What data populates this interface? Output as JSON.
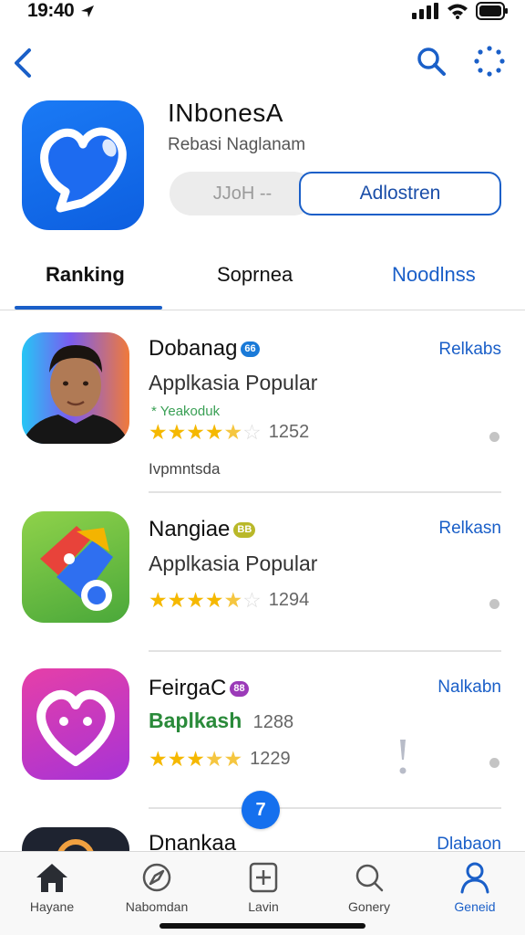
{
  "status_bar": {
    "time": "19:40"
  },
  "nav": {
    "back_icon": "chevron-left-icon",
    "search_icon": "search-icon",
    "more_icon": "dotted-circle-icon"
  },
  "hero": {
    "title": "INbonesA",
    "subtitle": "Rebasi Naglanam",
    "get_button": "JJoH --",
    "open_button": "Adlostren",
    "icon_color": "#1a7af5"
  },
  "tabs": [
    {
      "label": "Ranking",
      "active": true
    },
    {
      "label": "Soprnea",
      "active": false
    },
    {
      "label": "Noodlnss",
      "active": false
    }
  ],
  "apps": [
    {
      "name": "Dobanag",
      "badge": "66",
      "badge_color": "#1a7ad8",
      "category": "Applkasia Popular",
      "tag": "* Yeakoduk",
      "rating": 4.5,
      "rating_count": "1252",
      "note": "Ivpmntsda",
      "action": "Relkabs"
    },
    {
      "name": "Nangiae",
      "badge": "BB",
      "badge_color": "#b9b829",
      "category": "Applkasia Popular",
      "rating": 4.5,
      "rating_count": "1294",
      "action": "Relkasn"
    },
    {
      "name": "FeirgaC",
      "badge": "88",
      "badge_color": "#9b3ab8",
      "category": "Baplkash",
      "category_count": "1288",
      "rating": 4.5,
      "rating_count": "1229",
      "action": "Nalkabn"
    },
    {
      "name": "Dnankaa",
      "action": "Dlabaon"
    }
  ],
  "floating_badge": "7",
  "tab_bar": [
    {
      "label": "Hayane",
      "icon": "home-icon",
      "active": false
    },
    {
      "label": "Nabomdan",
      "icon": "compass-icon",
      "active": false
    },
    {
      "label": "Lavin",
      "icon": "plus-square-icon",
      "active": false
    },
    {
      "label": "Gonery",
      "icon": "search-icon",
      "active": false
    },
    {
      "label": "Geneid",
      "icon": "person-icon",
      "active": true
    }
  ],
  "colors": {
    "accent": "#1a5fc8",
    "star": "#f5b800"
  }
}
